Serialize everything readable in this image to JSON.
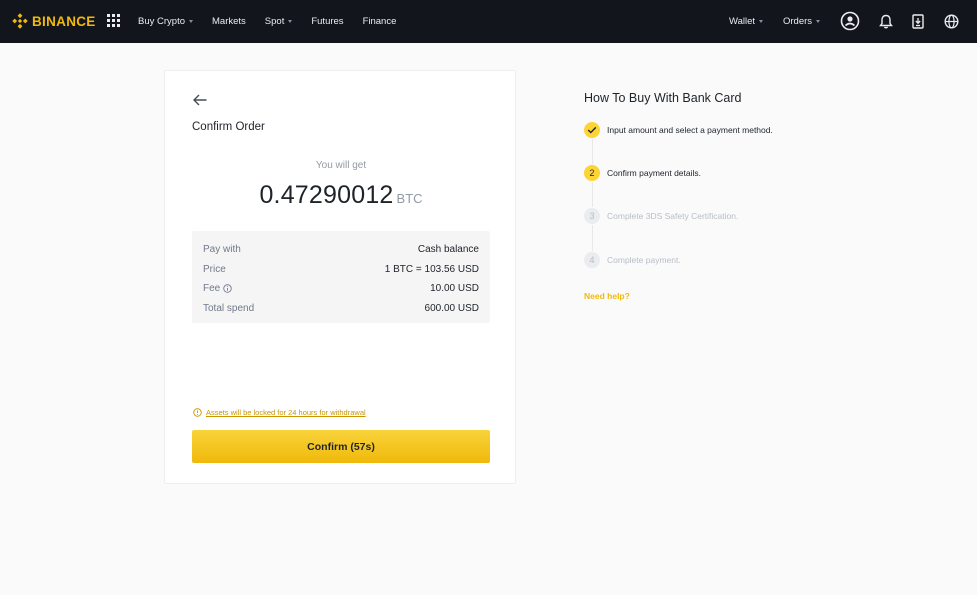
{
  "brand": {
    "name": "BINANCE",
    "color": "#f0b90b"
  },
  "nav": {
    "left_items": [
      {
        "label": "Buy Crypto",
        "dropdown": true
      },
      {
        "label": "Markets",
        "dropdown": false
      },
      {
        "label": "Spot",
        "dropdown": true
      },
      {
        "label": "Futures",
        "dropdown": false
      },
      {
        "label": "Finance",
        "dropdown": false
      }
    ],
    "right_items": [
      {
        "label": "Wallet",
        "dropdown": true
      },
      {
        "label": "Orders",
        "dropdown": true
      }
    ],
    "icons": [
      "apps-grid-icon",
      "user-account-icon",
      "bell-icon",
      "download-app-icon",
      "globe-icon"
    ]
  },
  "order": {
    "title": "Confirm Order",
    "you_will_get_label": "You will get",
    "amount": "0.47290012",
    "unit": "BTC",
    "details": [
      {
        "label": "Pay with",
        "value": "Cash balance"
      },
      {
        "label": "Price",
        "value": "1 BTC = 103.56 USD"
      },
      {
        "label": "Fee",
        "value": "10.00 USD",
        "info": true
      },
      {
        "label": "Total spend",
        "value": "600.00 USD"
      }
    ],
    "lock_note": "Assets will be locked for 24 hours for withdrawal",
    "confirm_label": "Confirm (57s)"
  },
  "howto": {
    "title": "How To Buy With Bank Card",
    "steps": [
      {
        "number": "1",
        "text": "Input amount and select a payment method.",
        "state": "done"
      },
      {
        "number": "2",
        "text": "Confirm payment details.",
        "state": "active"
      },
      {
        "number": "3",
        "text": "Complete 3DS Safety Certification.",
        "state": "pending"
      },
      {
        "number": "4",
        "text": "Complete payment.",
        "state": "pending"
      }
    ],
    "help_label": "Need help?"
  }
}
